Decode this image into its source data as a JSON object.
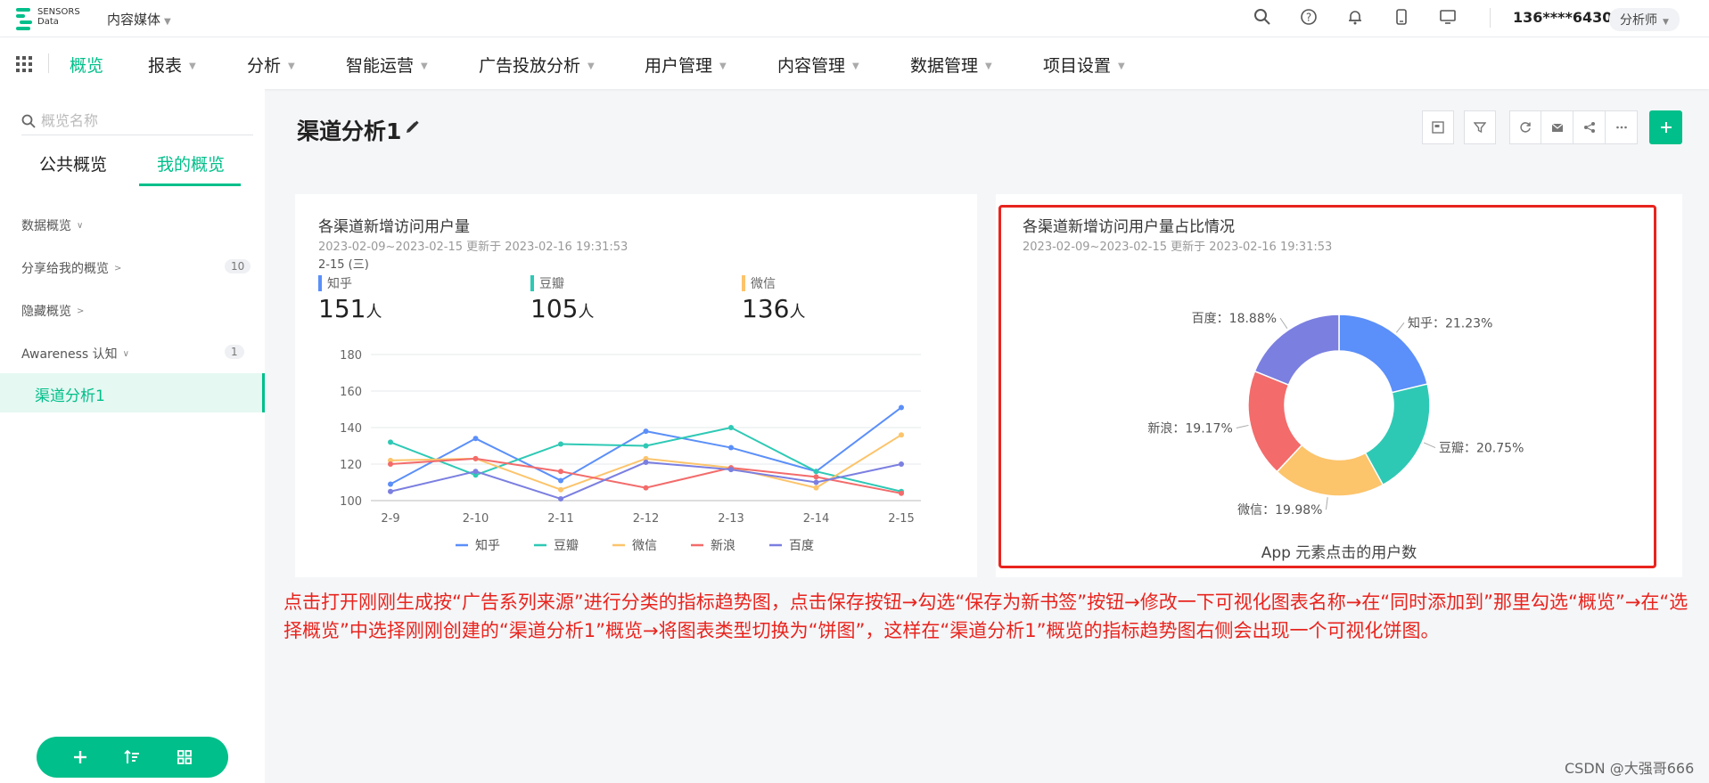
{
  "topbar": {
    "logo_line1": "SENSORS",
    "logo_line2": "Data",
    "project": "内容媒体",
    "icons": [
      "search-icon",
      "help-icon",
      "bell-icon",
      "mobile-icon",
      "monitor-icon"
    ],
    "user": "136****6430",
    "role": "分析师"
  },
  "nav": {
    "items": [
      "概览",
      "报表",
      "分析",
      "智能运营",
      "广告投放分析",
      "用户管理",
      "内容管理",
      "数据管理",
      "项目设置"
    ],
    "active_index": 0
  },
  "sidebar": {
    "search_placeholder": "概览名称",
    "tabs": [
      "公共概览",
      "我的概览"
    ],
    "active_tab": 1,
    "groups": [
      {
        "label": "数据概览",
        "chevron": "down"
      },
      {
        "label": "分享给我的概览",
        "chevron": "right",
        "badge": "10"
      },
      {
        "label": "隐藏概览",
        "chevron": "right"
      },
      {
        "label": "Awareness 认知",
        "chevron": "down",
        "badge": "1"
      }
    ],
    "selected_item": "渠道分析1"
  },
  "main": {
    "title": "渠道分析1"
  },
  "line_card": {
    "title": "各渠道新增访问用户量",
    "subtitle": "2023-02-09~2023-02-15 更新于 2023-02-16 19:31:53",
    "date_label": "2-15 (三)",
    "unit": "人",
    "metrics": [
      {
        "name": "知乎",
        "value": "151",
        "color": "#5b8ff9"
      },
      {
        "name": "豆瓣",
        "value": "105",
        "color": "#2ec9b5"
      },
      {
        "name": "微信",
        "value": "136",
        "color": "#fcc46b"
      }
    ]
  },
  "pie_card": {
    "title": "各渠道新增访问用户量占比情况",
    "subtitle": "2023-02-09~2023-02-15 更新于 2023-02-16 19:31:53",
    "caption": "App 元素点击的用户数"
  },
  "chart_data": [
    {
      "type": "line",
      "x": [
        "2-9",
        "2-10",
        "2-11",
        "2-12",
        "2-13",
        "2-14",
        "2-15"
      ],
      "ylim": [
        100,
        180
      ],
      "yticks": [
        100,
        120,
        140,
        160,
        180
      ],
      "grid": true,
      "legend_position": "bottom",
      "series": [
        {
          "name": "知乎",
          "color": "#5b8ff9",
          "values": [
            109,
            134,
            111,
            138,
            129,
            116,
            151
          ]
        },
        {
          "name": "豆瓣",
          "color": "#2ec9b5",
          "values": [
            132,
            114,
            131,
            130,
            140,
            116,
            105
          ]
        },
        {
          "name": "微信",
          "color": "#fcc46b",
          "values": [
            122,
            123,
            106,
            123,
            118,
            107,
            136
          ]
        },
        {
          "name": "新浪",
          "color": "#f36b6b",
          "values": [
            120,
            123,
            116,
            107,
            118,
            113,
            104
          ]
        },
        {
          "name": "百度",
          "color": "#7b7fe0",
          "values": [
            105,
            116,
            101,
            121,
            117,
            110,
            120
          ]
        }
      ]
    },
    {
      "type": "pie",
      "donut": true,
      "slices": [
        {
          "name": "知乎",
          "value": 21.23,
          "label": "知乎：21.23%",
          "color": "#5b8ff9"
        },
        {
          "name": "豆瓣",
          "value": 20.75,
          "label": "豆瓣：20.75%",
          "color": "#2ec9b5"
        },
        {
          "name": "微信",
          "value": 19.98,
          "label": "微信：19.98%",
          "color": "#fcc46b"
        },
        {
          "name": "新浪",
          "value": 19.17,
          "label": "新浪：19.17%",
          "color": "#f36b6b"
        },
        {
          "name": "百度",
          "value": 18.88,
          "label": "百度：18.88%",
          "color": "#7b7fe0"
        }
      ]
    }
  ],
  "annotation": "点击打开刚刚生成按“广告系列来源”进行分类的指标趋势图，点击保存按钮→勾选“保存为新书签”按钮→修改一下可视化图表名称→在“同时添加到”那里勾选“概览”→在“选择概览”中选择刚刚创建的“渠道分析1”概览→将图表类型切换为“饼图”，这样在“渠道分析1”概览的指标趋势图右侧会出现一个可视化饼图。",
  "watermark": "CSDN @大强哥666"
}
